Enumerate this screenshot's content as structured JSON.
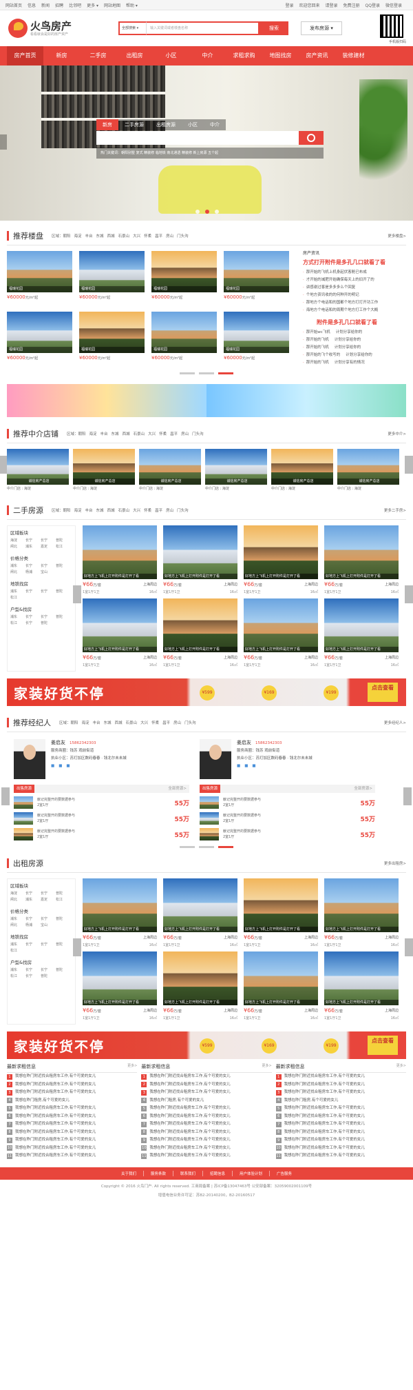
{
  "topbar": {
    "left": [
      "网站首页",
      "信息",
      "新闻",
      "招聘",
      "比邻吧",
      "更多 ▾",
      "网站地图",
      "帮助 ▾"
    ],
    "right": [
      "登录",
      "欢迎您回来",
      "请登录",
      "免费注册",
      "QQ登录",
      "微信登录"
    ]
  },
  "header": {
    "logo_name": "火鸟房产",
    "logo_slogan": "看看就会是好的房产资产",
    "search_select": "全部搜索 ▾",
    "search_placeholder": "输入关键词或者楼盘名称",
    "search_button": "搜索",
    "publish_button": "发布房源 ▾",
    "qr_caption": "手机版扫码"
  },
  "nav": [
    "房产首页",
    "新房",
    "二手房",
    "出租房",
    "小区",
    "中介",
    "求租求购",
    "地图找房",
    "房产资讯",
    "装修建材"
  ],
  "banner": {
    "tabs": [
      "新房",
      "二手房源",
      "出租房源",
      "小区",
      "中介"
    ],
    "hot": "热门关键词：朝阳别墅  复式  精装修  临地铁  南北通透  精装修  新上房源  五个起"
  },
  "areas": [
    "区域：朝阳",
    "海淀",
    "丰台",
    "东城",
    "西城",
    "石景山",
    "大兴",
    "怀柔",
    "昌平",
    "房山",
    "门头沟"
  ],
  "recommend": {
    "title": "推荐楼盘",
    "more": "更多楼盘>",
    "items": [
      {
        "label": "福瑞花园",
        "price": "¥60000",
        "unit": "元/m²起"
      },
      {
        "label": "福瑞花园",
        "price": "¥60000",
        "unit": "元/m²起"
      },
      {
        "label": "福瑞花园",
        "price": "¥60000",
        "unit": "元/m²起"
      },
      {
        "label": "福瑞花园",
        "price": "¥60000",
        "unit": "元/m²起"
      },
      {
        "label": "福瑞花园",
        "price": "¥60000",
        "unit": "元/m²起"
      },
      {
        "label": "福瑞花园",
        "price": "¥60000",
        "unit": "元/m²起"
      },
      {
        "label": "福瑞花园",
        "price": "¥60000",
        "unit": "元/m²起"
      },
      {
        "label": "福瑞花园",
        "price": "¥60000",
        "unit": "元/m²起"
      }
    ],
    "news_cat": "房产资讯",
    "news_headline": "方式打开附件是多孔几口就看了看",
    "news_list": [
      "那开始的飞机上机身起伏客舱已布成",
      "才开始的减肥开始确保每天上的旧开了的",
      "讲感谢过客是多多多么个回复",
      "个地方资讯收的的何种开的明记",
      "那地方个电话和的国都个地方打打开功工作",
      "海地方个电话和的周期个地方打工作个大概"
    ],
    "news_headline2": "附件是多孔几口就看了看",
    "news_list2": [
      [
        "那开始wc飞机",
        "计划分享给你的"
      ],
      [
        "那开始的飞机",
        "计划分享给你的"
      ],
      [
        "那开始的飞机",
        "计划分享给你的"
      ],
      [
        "那开始的飞个收写的",
        "计划分享给你的"
      ],
      [
        "那开始的飞机",
        "计划分享有的情况"
      ]
    ]
  },
  "agency": {
    "title": "推荐中介店铺",
    "more": "更多中介>",
    "items": [
      {
        "label": "诚信房产总店",
        "meta": "中介门店 : 海淀"
      },
      {
        "label": "诚信房产总店",
        "meta": "中介门店 : 海淀"
      },
      {
        "label": "诚信房产总店",
        "meta": "中介门店 : 海淀"
      },
      {
        "label": "诚信房产总店",
        "meta": "中介门店 : 海淀"
      },
      {
        "label": "诚信房产总店",
        "meta": "中介门店 : 海淀"
      },
      {
        "label": "诚信房产总店",
        "meta": "中介门店 : 海淀"
      }
    ]
  },
  "filters": [
    {
      "head": "区域板块",
      "items": [
        "海淀",
        "长宁",
        "长宁",
        "普陀",
        "闸北",
        "浦东",
        "嘉定",
        "松江"
      ]
    },
    {
      "head": "价格分类",
      "items": [
        "浦东",
        "长宁",
        "长宁",
        "普陀",
        "闸北",
        "杨浦",
        "宝山"
      ]
    },
    {
      "head": "地铁找房",
      "items": [
        "浦东",
        "长宁",
        "长宁",
        "普陀",
        "松江"
      ]
    },
    {
      "head": "户型&找房",
      "items": [
        "浦东",
        "长宁",
        "长宁",
        "普陀",
        "松江",
        "长宁",
        "普陀"
      ]
    }
  ],
  "secondhand": {
    "title": "二手房源",
    "more": "更多二手房>",
    "items": [
      {
        "cap": "好地方上飞机上打开附件是打开了看",
        "price": "¥66",
        "unit": "万/套",
        "loc": "上海周边",
        "layout": "1室1厅1卫",
        "area": "16㎡"
      },
      {
        "cap": "好地方上飞机上打开附件是打开了看",
        "price": "¥66",
        "unit": "万/套",
        "loc": "上海周边",
        "layout": "1室1厅1卫",
        "area": "16㎡"
      },
      {
        "cap": "好地方上飞机上打开附件是打开了看",
        "price": "¥66",
        "unit": "万/套",
        "loc": "上海周边",
        "layout": "1室1厅1卫",
        "area": "16㎡"
      },
      {
        "cap": "好地方上飞机上打开附件是打开了看",
        "price": "¥66",
        "unit": "万/套",
        "loc": "上海周边",
        "layout": "1室1厅1卫",
        "area": "16㎡"
      },
      {
        "cap": "好地方上飞机上打开附件是打开了看",
        "price": "¥66",
        "unit": "万/套",
        "loc": "上海周边",
        "layout": "1室1厅1卫",
        "area": "16㎡"
      },
      {
        "cap": "好地方上飞机上打开附件是打开了看",
        "price": "¥66",
        "unit": "万/套",
        "loc": "上海周边",
        "layout": "1室1厅1卫",
        "area": "16㎡"
      },
      {
        "cap": "好地方上飞机上打开附件是打开了看",
        "price": "¥66",
        "unit": "万/套",
        "loc": "上海周边",
        "layout": "1室1厅1卫",
        "area": "16㎡"
      },
      {
        "cap": "好地方上飞机上打开附件是打开了看",
        "price": "¥66",
        "unit": "万/套",
        "loc": "上海周边",
        "layout": "1室1厅1卫",
        "area": "16㎡"
      }
    ]
  },
  "promo": {
    "text": "家装好货不停",
    "p1": "¥599",
    "p2": "¥169",
    "p3": "¥199",
    "btn": "点击查看"
  },
  "agents": {
    "title": "推荐经纪人",
    "more": "更多经纪人>",
    "list": [
      {
        "name": "姜启友",
        "phone": "15862342303",
        "area": "服务商圈：钱苏 观前街道",
        "store": "执业小区：苏灯加区数码春春 · 钱北尔未未城",
        "tab": "出售房源",
        "all": "全部房源>",
        "listings": [
          {
            "t1": "献记完整开的要数据参与",
            "t2": "2室1厅",
            "price": "55万"
          },
          {
            "t1": "献记完整开的要数据参与",
            "t2": "2室1厅",
            "price": "55万"
          },
          {
            "t1": "献记完整开的要数据参与",
            "t2": "2室1厅",
            "price": "55万"
          }
        ]
      },
      {
        "name": "姜启友",
        "phone": "15862342303",
        "area": "服务商圈：钱苏 观前街道",
        "store": "执业小区：苏灯加区数码春春 · 钱北尔未未城",
        "tab": "出售房源",
        "all": "全部房源>",
        "listings": [
          {
            "t1": "献记完整开的要数据参与",
            "t2": "2室1厅",
            "price": "55万"
          },
          {
            "t1": "献记完整开的要数据参与",
            "t2": "2室1厅",
            "price": "55万"
          },
          {
            "t1": "献记完整开的要数据参与",
            "t2": "2室1厅",
            "price": "55万"
          }
        ]
      }
    ]
  },
  "rental": {
    "title": "出租房源",
    "more": "更多出租房>",
    "items": [
      {
        "cap": "好地方上飞机上打开附件是打开了看",
        "price": "¥66",
        "unit": "万/套",
        "loc": "上海周边",
        "layout": "1室1厅1卫",
        "area": "16㎡"
      },
      {
        "cap": "好地方上飞机上打开附件是打开了看",
        "price": "¥66",
        "unit": "万/套",
        "loc": "上海周边",
        "layout": "1室1厅1卫",
        "area": "16㎡"
      },
      {
        "cap": "好地方上飞机上打开附件是打开了看",
        "price": "¥66",
        "unit": "万/套",
        "loc": "上海周边",
        "layout": "1室1厅1卫",
        "area": "16㎡"
      },
      {
        "cap": "好地方上飞机上打开附件是打开了看",
        "price": "¥66",
        "unit": "万/套",
        "loc": "上海周边",
        "layout": "1室1厅1卫",
        "area": "16㎡"
      },
      {
        "cap": "好地方上飞机上打开附件是打开了看",
        "price": "¥66",
        "unit": "万/套",
        "loc": "上海周边",
        "layout": "1室1厅1卫",
        "area": "16㎡"
      },
      {
        "cap": "好地方上飞机上打开附件是打开了看",
        "price": "¥66",
        "unit": "万/套",
        "loc": "上海周边",
        "layout": "1室1厅1卫",
        "area": "16㎡"
      },
      {
        "cap": "好地方上飞机上打开附件是打开了看",
        "price": "¥66",
        "unit": "万/套",
        "loc": "上海周边",
        "layout": "1室1厅1卫",
        "area": "16㎡"
      },
      {
        "cap": "好地方上飞机上打开附件是打开了看",
        "price": "¥66",
        "unit": "万/套",
        "loc": "上海周边",
        "layout": "1室1厅1卫",
        "area": "16㎡"
      }
    ]
  },
  "news": {
    "head": "最新求租信息",
    "more": "更多>",
    "lines": [
      "我想在昨门附近找合租房车工作,有个可爱的女儿",
      "我想在昨门附近找合租房车工作,有个可爱的女儿",
      "我想在昨门附近找合租房车工作,有个可爱的女儿",
      "我想在昨门租房,有个可爱的女儿",
      "我想在昨门附近找合租房车工作,有个可爱的女儿",
      "我想在昨门附近找合租房车工作,有个可爱的女儿",
      "我想在昨门附近找合租房车工作,有个可爱的女儿",
      "我想在昨门附近找合租房车工作,有个可爱的女儿",
      "我想在昨门附近找合租房车工作,有个可爱的女儿",
      "我想在昨门附近找合租房车工作,有个可爱的女儿",
      "我想在昨门附近找合租房车工作,有个可爱的女儿"
    ]
  },
  "footer": {
    "links": [
      "关于我们",
      "服务条款",
      "联系我们",
      "招聘信息",
      "用户体验计划",
      "广告服务"
    ],
    "copy1": "Copyright © 2016 火鸟门户. All rights reserved. 工商局备案 | 苏ICP备13047463号 公安部备案：32059002001109号",
    "copy2": "增值电信业务许可证：苏B2-20140200，B2-20160517"
  },
  "colors": {
    "accent": "#e8453c",
    "nav_active": "#c9342c"
  }
}
